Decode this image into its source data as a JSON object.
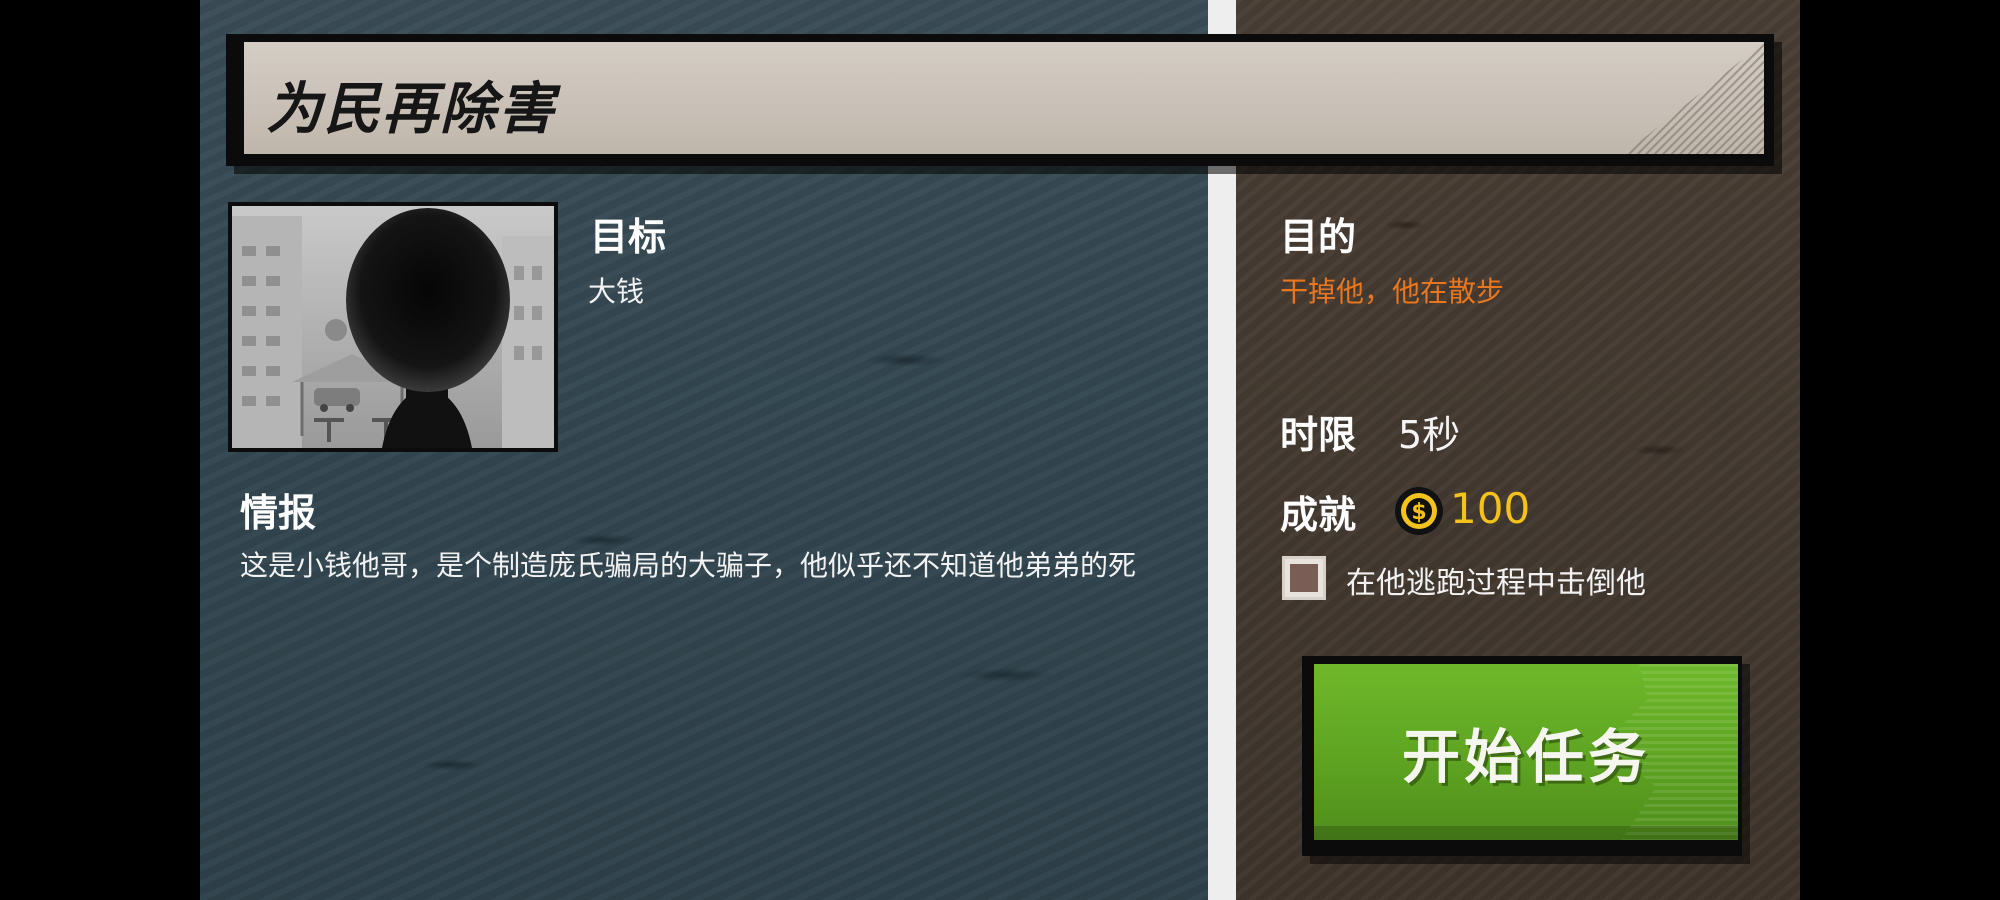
{
  "mission": {
    "title": "为民再除害"
  },
  "target": {
    "label": "目标",
    "name": "大钱",
    "portrait_icon": "silhouette-portrait"
  },
  "intel": {
    "label": "情报",
    "text": "这是小钱他哥，是个制造庞氏骗局的大骗子，他似乎还不知道他弟弟的死"
  },
  "objective": {
    "label": "目的",
    "text": "干掉他，他在散步",
    "text_color": "#e8761f"
  },
  "time_limit": {
    "label": "时限",
    "value": "5秒"
  },
  "reward": {
    "label": "成就",
    "coin_icon": "coin-icon",
    "value": "100",
    "value_color": "#f4c21a"
  },
  "bonus": {
    "checked": false,
    "text": "在他逃跑过程中击倒他"
  },
  "start_button": {
    "label": "开始任务",
    "color": "#5ea422"
  }
}
